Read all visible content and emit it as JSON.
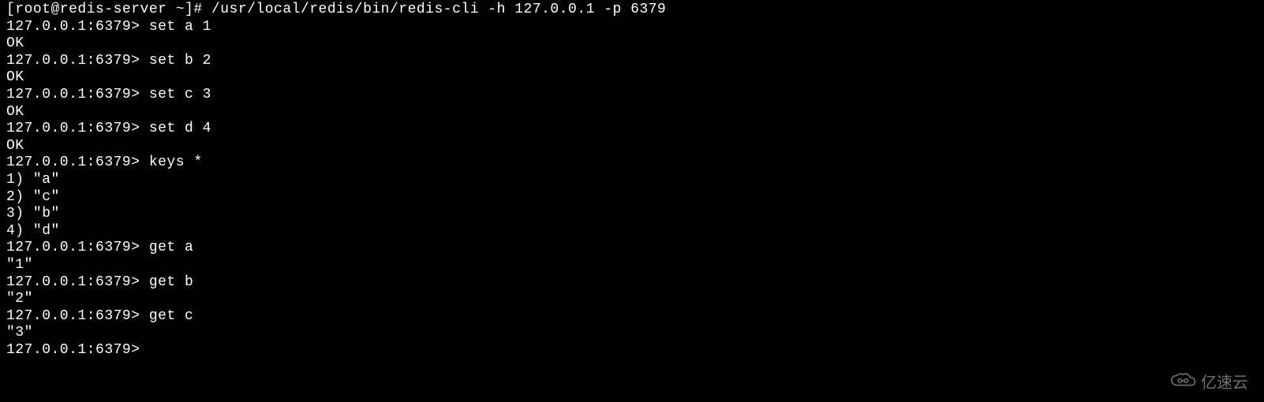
{
  "terminal": {
    "lines": [
      "[root@redis-server ~]# /usr/local/redis/bin/redis-cli -h 127.0.0.1 -p 6379",
      "127.0.0.1:6379> set a 1",
      "OK",
      "127.0.0.1:6379> set b 2",
      "OK",
      "127.0.0.1:6379> set c 3",
      "OK",
      "127.0.0.1:6379> set d 4",
      "OK",
      "127.0.0.1:6379> keys *",
      "1) \"a\"",
      "2) \"c\"",
      "3) \"b\"",
      "4) \"d\"",
      "127.0.0.1:6379> get a",
      "\"1\"",
      "127.0.0.1:6379> get b",
      "\"2\"",
      "127.0.0.1:6379> get c",
      "\"3\"",
      "127.0.0.1:6379>"
    ]
  },
  "watermark": {
    "text": "亿速云"
  }
}
